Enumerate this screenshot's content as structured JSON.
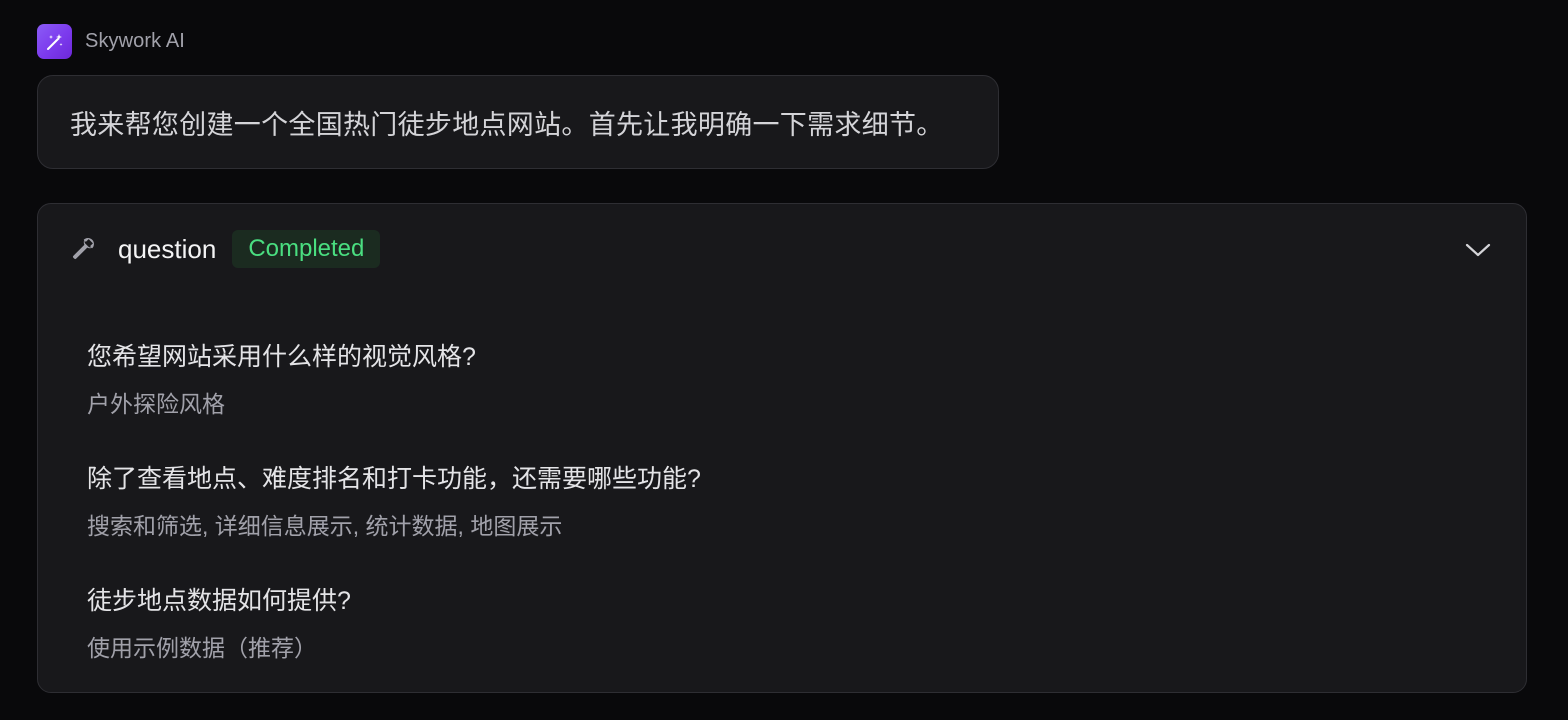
{
  "agent": {
    "name": "Skywork AI",
    "logo_icon": "magic-wand-icon",
    "logo_color": "#7c3aed"
  },
  "message": {
    "text": "我来帮您创建一个全国热门徒步地点网站。首先让我明确一下需求细节。"
  },
  "tool": {
    "icon": "wrench-icon",
    "name": "question",
    "status": "Completed",
    "status_color": "#4ade80",
    "toggle_icon": "chevron-down-icon",
    "items": [
      {
        "question": "您希望网站采用什么样的视觉风格?",
        "answer": "户外探险风格"
      },
      {
        "question": "除了查看地点、难度排名和打卡功能，还需要哪些功能?",
        "answer": "搜索和筛选, 详细信息展示, 统计数据, 地图展示"
      },
      {
        "question": "徒步地点数据如何提供?",
        "answer": "使用示例数据（推荐）"
      }
    ]
  }
}
